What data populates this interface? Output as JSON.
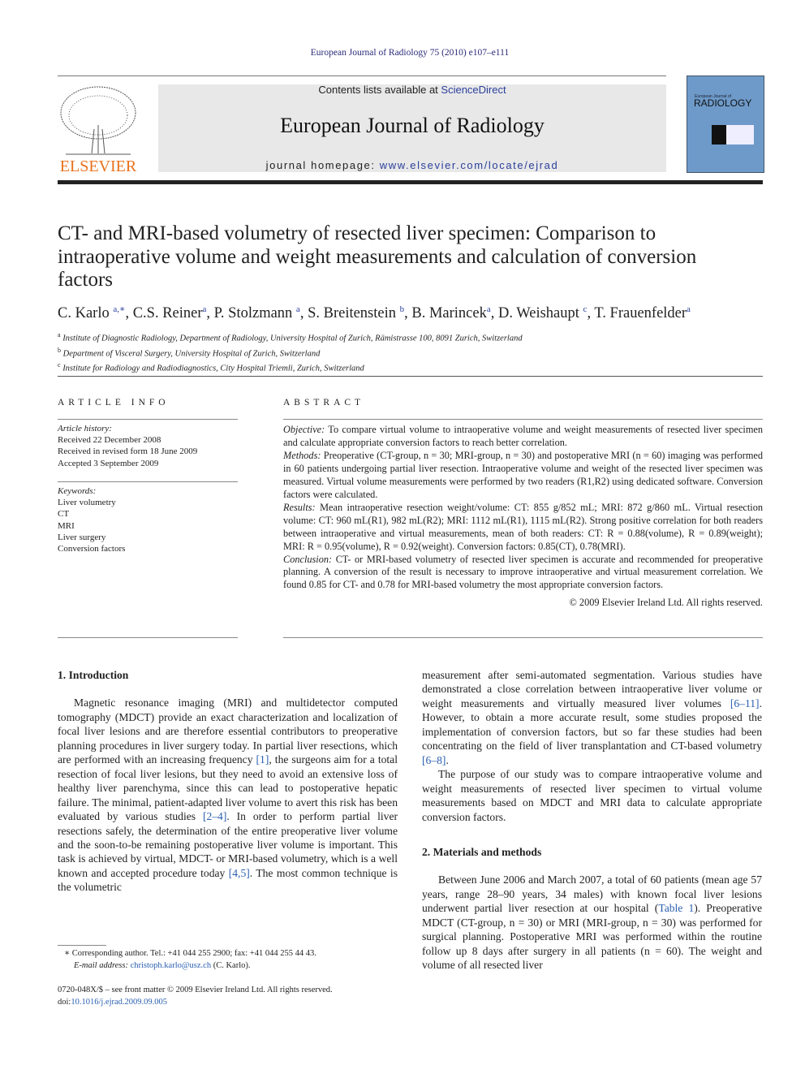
{
  "header": {
    "journal_ref": "European Journal of Radiology 75 (2010) e107–e111",
    "contents_prefix": "Contents lists available at ",
    "sciencedirect": "ScienceDirect",
    "journal_title": "European Journal of Radiology",
    "homepage_prefix": "journal homepage: ",
    "homepage_url": "www.elsevier.com/locate/ejrad",
    "publisher_logo": "ELSEVIER",
    "cover_title": "RADIOLOGY",
    "cover_subtitle": "European Journal of"
  },
  "article": {
    "title": "CT- and MRI-based volumetry of resected liver specimen: Comparison to intraoperative volume and weight measurements and calculation of conversion factors",
    "authors": [
      {
        "name": "C. Karlo",
        "sup": "a,∗"
      },
      {
        "name": "C.S. Reiner",
        "sup": "a"
      },
      {
        "name": "P. Stolzmann",
        "sup": "a"
      },
      {
        "name": "S. Breitenstein",
        "sup": "b"
      },
      {
        "name": "B. Marincek",
        "sup": "a"
      },
      {
        "name": "D. Weishaupt",
        "sup": "c"
      },
      {
        "name": "T. Frauenfelder",
        "sup": "a"
      }
    ],
    "affiliations": [
      {
        "sup": "a",
        "text": "Institute of Diagnostic Radiology, Department of Radiology, University Hospital of Zurich, Rämistrasse 100, 8091 Zurich, Switzerland"
      },
      {
        "sup": "b",
        "text": "Department of Visceral Surgery, University Hospital of Zurich, Switzerland"
      },
      {
        "sup": "c",
        "text": "Institute for Radiology and Radiodiagnostics, City Hospital Triemli, Zurich, Switzerland"
      }
    ]
  },
  "article_info": {
    "heading": "ARTICLE INFO",
    "history_label": "Article history:",
    "history": [
      "Received 22 December 2008",
      "Received in revised form 18 June 2009",
      "Accepted 3 September 2009"
    ],
    "keywords_label": "Keywords:",
    "keywords": [
      "Liver volumetry",
      "CT",
      "MRI",
      "Liver surgery",
      "Conversion factors"
    ]
  },
  "abstract": {
    "heading": "ABSTRACT",
    "sections": [
      {
        "label": "Objective:",
        "text": " To compare virtual volume to intraoperative volume and weight measurements of resected liver specimen and calculate appropriate conversion factors to reach better correlation."
      },
      {
        "label": "Methods:",
        "text": " Preoperative (CT-group, n = 30; MRI-group, n = 30) and postoperative MRI (n = 60) imaging was performed in 60 patients undergoing partial liver resection. Intraoperative volume and weight of the resected liver specimen was measured. Virtual volume measurements were performed by two readers (R1,R2) using dedicated software. Conversion factors were calculated."
      },
      {
        "label": "Results:",
        "text": " Mean intraoperative resection weight/volume: CT: 855 g/852 mL; MRI: 872 g/860 mL. Virtual resection volume: CT: 960 mL(R1), 982 mL(R2); MRI: 1112 mL(R1), 1115 mL(R2). Strong positive correlation for both readers between intraoperative and virtual measurements, mean of both readers: CT: R = 0.88(volume), R = 0.89(weight); MRI: R = 0.95(volume), R = 0.92(weight). Conversion factors: 0.85(CT), 0.78(MRI)."
      },
      {
        "label": "Conclusion:",
        "text": " CT- or MRI-based volumetry of resected liver specimen is accurate and recommended for preoperative planning. A conversion of the result is necessary to improve intraoperative and virtual measurement correlation. We found 0.85 for CT- and 0.78 for MRI-based volumetry the most appropriate conversion factors."
      }
    ],
    "copyright": "© 2009 Elsevier Ireland Ltd. All rights reserved."
  },
  "body": {
    "intro_heading": "1.  Introduction",
    "intro_p1": [
      "Magnetic resonance imaging (MRI) and multidetector computed tomography (MDCT) provide an exact characterization and localization of focal liver lesions and are therefore essential contributors to preoperative planning procedures in liver surgery today. In partial liver resections, which are performed with an increasing frequency ",
      "[1]",
      ", the surgeons aim for a total resection of focal liver lesions, but they need to avoid an extensive loss of healthy liver parenchyma, since this can lead to postoperative hepatic failure. The minimal, patient-adapted liver volume to avert this risk has been evaluated by various studies ",
      "[2–4]",
      ". In order to perform partial liver resections safely, the determination of the entire preoperative liver volume and the soon-to-be remaining postoperative liver volume is important. This task is achieved by virtual, MDCT- or MRI-based volumetry, which is a well known and accepted procedure today ",
      "[4,5]",
      ". The most common technique is the volumetric"
    ],
    "intro_cont": [
      "measurement after semi-automated segmentation. Various studies have demonstrated a close correlation between intraoperative liver volume or weight measurements and virtually measured liver volumes ",
      "[6–11]",
      ". However, to obtain a more accurate result, some studies proposed the implementation of conversion factors, but so far these studies had been concentrating on the field of liver transplantation and CT-based volumetry ",
      "[6–8]",
      "."
    ],
    "intro_p2": "The purpose of our study was to compare intraoperative volume and weight measurements of resected liver specimen to virtual volume measurements based on MDCT and MRI data to calculate appropriate conversion factors.",
    "methods_heading": "2.  Materials and methods",
    "methods_p1": [
      "Between June 2006 and March 2007, a total of 60 patients (mean age 57 years, range 28–90 years, 34 males) with known focal liver lesions underwent partial liver resection at our hospital (",
      "Table 1",
      "). Preoperative MDCT (CT-group, n = 30) or MRI (MRI-group, n = 30) was performed for surgical planning. Postoperative MRI was performed within the routine follow up 8 days after surgery in all patients (n = 60). The weight and volume of all resected liver"
    ]
  },
  "footnote": {
    "marker": "∗",
    "text": "Corresponding author. Tel.: +41 044 255 2900; fax: +41 044 255 44 43.",
    "email_label": "E-mail address:",
    "email": "christoph.karlo@usz.ch",
    "email_suffix": " (C. Karlo)."
  },
  "footer": {
    "issn": "0720-048X/$ – see front matter © 2009 Elsevier Ireland Ltd. All rights reserved.",
    "doi_label": "doi:",
    "doi": "10.1016/j.ejrad.2009.09.005"
  },
  "colors": {
    "link": "#2a3f9a",
    "elsevier_orange": "#e9711c",
    "banner_gray": "#e8e8e9",
    "cover_blue": "#6d9ac9"
  }
}
